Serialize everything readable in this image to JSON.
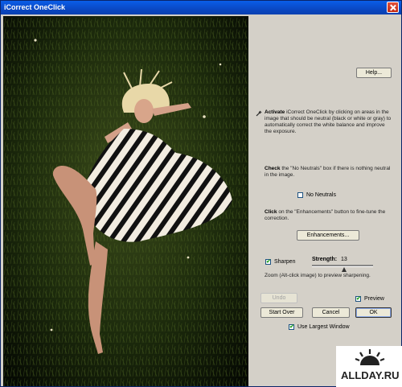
{
  "window": {
    "title": "iCorrect OneClick"
  },
  "panel": {
    "help_label": "Help...",
    "activate_bold": "Activate",
    "activate_text": "iCorrect OneClick by clicking on areas in the image that should be neutral (black or white or gray) to automatically correct the white balance and improve the exposure.",
    "check_bold": "Check",
    "check_text": "the \"No Neutrals\" box if there is nothing neutral in the image.",
    "no_neutrals_label": "No Neutrals",
    "no_neutrals_checked": false,
    "click_bold": "Click",
    "click_text": "on the \"Enhancements\" button to fine-tune the correction.",
    "enhancements_label": "Enhancements...",
    "sharpen_label": "Sharpen",
    "sharpen_checked": true,
    "strength_label": "Strength:",
    "strength_value": "13",
    "zoom_text": "Zoom (Alt-click image) to preview sharpening.",
    "undo_label": "Undo",
    "preview_label": "Preview",
    "preview_checked": true,
    "start_over_label": "Start Over",
    "cancel_label": "Cancel",
    "ok_label": "OK",
    "largest_window_label": "Use Largest Window",
    "largest_window_checked": true
  },
  "watermark": {
    "text": "ALLDAY.RU"
  },
  "icons": {
    "activate": "eyedropper-icon",
    "close": "close-icon"
  }
}
